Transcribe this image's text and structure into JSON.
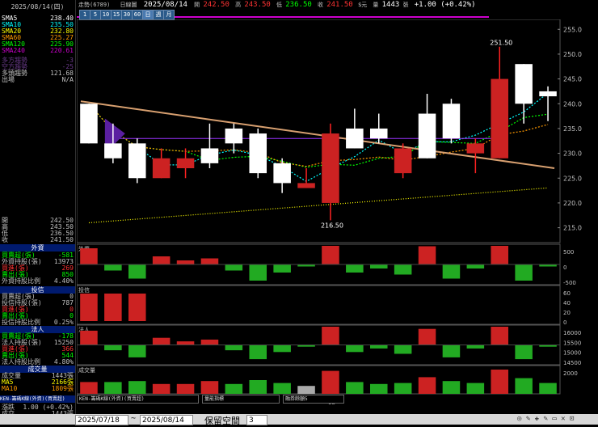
{
  "header": {
    "title": "走勢(6789)",
    "mode": "日線圖",
    "date": "2025/08/14",
    "open_label": "開",
    "open": "242.50",
    "high_label": "高",
    "high": "243.50",
    "low_label": "低",
    "low": "236.50",
    "close_label": "收",
    "close": "241.50",
    "currency": "$元",
    "vol_label": "量",
    "volume": "1443",
    "vol_unit": "張",
    "change": "+1.00 (+0.42%)"
  },
  "timeframes": [
    "1",
    "5",
    "10",
    "15",
    "30",
    "60",
    "日",
    "週",
    "月"
  ],
  "timeframe_active": "日",
  "left": {
    "date": "2025/08/14(四)",
    "ma": [
      {
        "label": "SMA5",
        "value": "238.40",
        "color": "#ffffff"
      },
      {
        "label": "SMA10",
        "value": "235.50",
        "color": "#00ffff"
      },
      {
        "label": "SMA20",
        "value": "232.80",
        "color": "#ffff00"
      },
      {
        "label": "SMA60",
        "value": "225.27",
        "color": "#ff9900"
      },
      {
        "label": "SMA120",
        "value": "225.90",
        "color": "#00ff00"
      },
      {
        "label": "SMA240",
        "value": "220.61",
        "color": "#cc00cc"
      }
    ],
    "extra": [
      {
        "label": "多方趨勢",
        "value": "-3"
      },
      {
        "label": "空方趨勢",
        "value": "-25"
      },
      {
        "label": "多頭趨勢",
        "value": "121.68"
      },
      {
        "label": "出場",
        "value": "N/A"
      }
    ],
    "ohlc": [
      {
        "label": "開",
        "value": "242.50"
      },
      {
        "label": "高",
        "value": "243.50"
      },
      {
        "label": "低",
        "value": "236.50"
      },
      {
        "label": "收",
        "value": "241.50"
      }
    ],
    "foreign_title": "外資",
    "foreign": [
      {
        "label": "買賣超(張)",
        "value": "-581",
        "color": "#00ff00"
      },
      {
        "label": "外資持股(張)",
        "value": "13973",
        "color": "#c0c0c0"
      },
      {
        "label": "買進(張)",
        "value": "269",
        "color": "#ff3333"
      },
      {
        "label": "賣出(張)",
        "value": "850",
        "color": "#00ff00"
      },
      {
        "label": "外資持股比例",
        "value": "4.40%",
        "color": "#c0c0c0"
      }
    ],
    "trust_title": "投信",
    "trust": [
      {
        "label": "買賣超(張)",
        "value": "0",
        "color": "#c0c0c0"
      },
      {
        "label": "投信持股(張)",
        "value": "787",
        "color": "#c0c0c0"
      },
      {
        "label": "買進(張)",
        "value": "0",
        "color": "#ff3333"
      },
      {
        "label": "賣出(張)",
        "value": "0",
        "color": "#00ff00"
      },
      {
        "label": "投信持股比例",
        "value": "0.25%",
        "color": "#c0c0c0"
      }
    ],
    "legal_title": "法人",
    "legal": [
      {
        "label": "買賣超(張)",
        "value": "-178",
        "color": "#00ff00"
      },
      {
        "label": "法人持股(張)",
        "value": "15250",
        "color": "#c0c0c0"
      },
      {
        "label": "買進(張)",
        "value": "366",
        "color": "#ff3333"
      },
      {
        "label": "賣出(張)",
        "value": "544",
        "color": "#00ff00"
      },
      {
        "label": "法人持股比例",
        "value": "4.80%",
        "color": "#c0c0c0"
      }
    ],
    "volume_title": "成交量",
    "volume": [
      {
        "label": "成交量",
        "value": "1443張",
        "color": "#c0c0c0"
      },
      {
        "label": "MA5",
        "value": "2166張",
        "color": "#ffff00"
      },
      {
        "label": "MA10",
        "value": "1809張",
        "color": "#ff9900"
      }
    ],
    "footer_tab": "KEN-籌碼K線(外資)(買賣超)",
    "footer_rows": [
      {
        "label": "漲跌",
        "value": "1.00 (+0.42%)"
      },
      {
        "label": "成交",
        "value": "1443張"
      }
    ]
  },
  "price_axis": [
    "255.0",
    "250.0",
    "245.0",
    "240.0",
    "235.0",
    "230.0",
    "225.0",
    "220.0",
    "215.0"
  ],
  "annotations": {
    "high": "251.50",
    "low": "216.50"
  },
  "sub_panels": {
    "foreign": {
      "title": "外資",
      "ticks": [
        "500",
        "0",
        "-500"
      ]
    },
    "trust": {
      "title": "投信",
      "ticks": [
        "60",
        "40",
        "20",
        "0"
      ]
    },
    "legal": {
      "title": "法人",
      "ticks": [
        "16000",
        "15500",
        "15000",
        "14500"
      ]
    },
    "volume": {
      "title": "成交量",
      "ticks": [
        "2000"
      ]
    }
  },
  "x_label": "08",
  "legend_selects": [
    "KEN-籌碼K線(外資)(買賣超)",
    "量能指標",
    "融券餘額5"
  ],
  "bottom": {
    "from": "2025/07/18",
    "tilde": "~",
    "to": "2025/08/14",
    "keep_label": "保留空間",
    "keep_value": "3"
  },
  "chart_data": {
    "type": "candlestick",
    "candles": [
      {
        "o": 232,
        "h": 240,
        "l": 232,
        "c": 240
      },
      {
        "o": 232,
        "h": 236,
        "l": 228,
        "c": 229
      },
      {
        "o": 232,
        "h": 233,
        "l": 224,
        "c": 225
      },
      {
        "o": 225,
        "h": 231,
        "l": 225,
        "c": 229
      },
      {
        "o": 227,
        "h": 231,
        "l": 225,
        "c": 229
      },
      {
        "o": 228,
        "h": 236,
        "l": 227,
        "c": 231
      },
      {
        "o": 235,
        "h": 236,
        "l": 230,
        "c": 232
      },
      {
        "o": 234,
        "h": 235,
        "l": 225,
        "c": 226
      },
      {
        "o": 228,
        "h": 229,
        "l": 222,
        "c": 224
      },
      {
        "o": 224,
        "h": 227,
        "l": 223,
        "c": 223
      },
      {
        "o": 220,
        "h": 236,
        "l": 216.5,
        "c": 234
      },
      {
        "o": 235,
        "h": 239,
        "l": 231,
        "c": 231
      },
      {
        "o": 235,
        "h": 238,
        "l": 232,
        "c": 233
      },
      {
        "o": 231,
        "h": 232,
        "l": 225,
        "c": 226
      },
      {
        "o": 229,
        "h": 242,
        "l": 229,
        "c": 238
      },
      {
        "o": 240,
        "h": 241,
        "l": 232,
        "c": 233
      },
      {
        "o": 232,
        "h": 233,
        "l": 226,
        "c": 230
      },
      {
        "o": 229,
        "h": 251.5,
        "l": 229,
        "c": 245
      },
      {
        "o": 248,
        "h": 248,
        "l": 236,
        "c": 240
      },
      {
        "o": 242.5,
        "h": 243.5,
        "l": 236.5,
        "c": 241.5
      }
    ],
    "ylim": [
      212,
      257
    ]
  }
}
